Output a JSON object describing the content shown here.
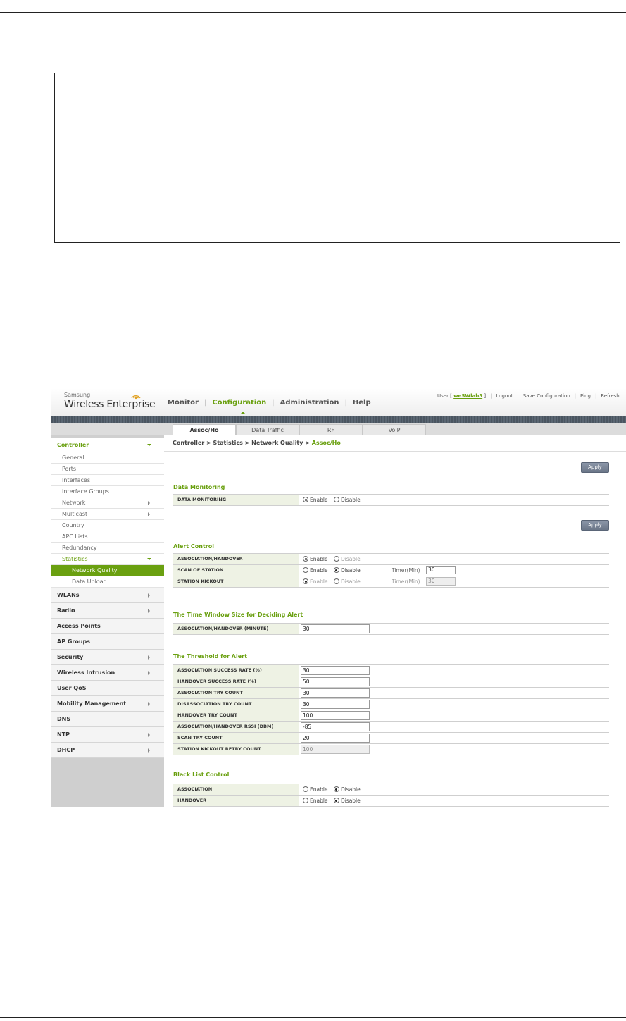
{
  "header": {
    "brand_small": "Samsung",
    "brand_big": "Wireless Enterprise",
    "nav": [
      "Monitor",
      "Configuration",
      "Administration",
      "Help"
    ],
    "active_nav": "Configuration",
    "user_prefix": "User [",
    "user_name": "weSWlab3",
    "user_suffix": "]",
    "links": [
      "Logout",
      "Save Configuration",
      "Ping",
      "Refresh"
    ]
  },
  "tabs": [
    "Assoc/Ho",
    "Data Traffic",
    "RF",
    "VoIP"
  ],
  "active_tab": "Assoc/Ho",
  "sidebar": {
    "controller": {
      "label": "Controller",
      "items": [
        "General",
        "Ports",
        "Interfaces",
        "Interface Groups",
        "Network",
        "Multicast",
        "Country",
        "APC Lists",
        "Redundancy",
        "Statistics"
      ],
      "statistics_items": [
        "Network Quality",
        "Data Upload"
      ]
    },
    "sections": [
      "WLANs",
      "Radio",
      "Access Points",
      "AP Groups",
      "Security",
      "Wireless Intrusion",
      "User QoS",
      "Mobility Management",
      "DNS",
      "NTP",
      "DHCP"
    ]
  },
  "breadcrumb": {
    "parts": [
      "Controller",
      "Statistics",
      "Network Quality"
    ],
    "current": "Assoc/Ho",
    "separator": ">"
  },
  "apply_label": "Apply",
  "options": {
    "enable": "Enable",
    "disable": "Disable",
    "timer": "Timer(Min)"
  },
  "data_monitoring": {
    "title": "Data Monitoring",
    "rows": [
      {
        "label": "DATA MONITORING",
        "value": "Enable"
      }
    ]
  },
  "alert_control": {
    "title": "Alert Control",
    "rows": [
      {
        "label": "ASSOCIATION/HANDOVER",
        "value": "Enable"
      },
      {
        "label": "SCAN OF STATION",
        "value": "Disable",
        "timer": "30"
      },
      {
        "label": "STATION KICKOUT",
        "value": "Enable",
        "timer": "30"
      }
    ]
  },
  "time_window": {
    "title": "The Time Window Size for Deciding Alert",
    "rows": [
      {
        "label": "ASSOCIATION/HANDOVER (MINUTE)",
        "value": "30"
      }
    ]
  },
  "threshold": {
    "title": "The Threshold for Alert",
    "rows": [
      {
        "label": "ASSOCIATION SUCCESS RATE (%)",
        "value": "30"
      },
      {
        "label": "HANDOVER SUCCESS RATE (%)",
        "value": "50"
      },
      {
        "label": "ASSOCIATION TRY COUNT",
        "value": "30"
      },
      {
        "label": "DISASSOCIATION TRY COUNT",
        "value": "30"
      },
      {
        "label": "HANDOVER TRY COUNT",
        "value": "100"
      },
      {
        "label": "ASSOCIATION/HANDOVER RSSI (DBM)",
        "value": "-85"
      },
      {
        "label": "SCAN TRY COUNT",
        "value": "20"
      },
      {
        "label": "STATION KICKOUT RETRY COUNT",
        "value": "100"
      }
    ]
  },
  "black_list": {
    "title": "Black List Control",
    "rows": [
      {
        "label": "ASSOCIATION",
        "value": "Disable"
      },
      {
        "label": "HANDOVER",
        "value": "Disable"
      }
    ]
  }
}
